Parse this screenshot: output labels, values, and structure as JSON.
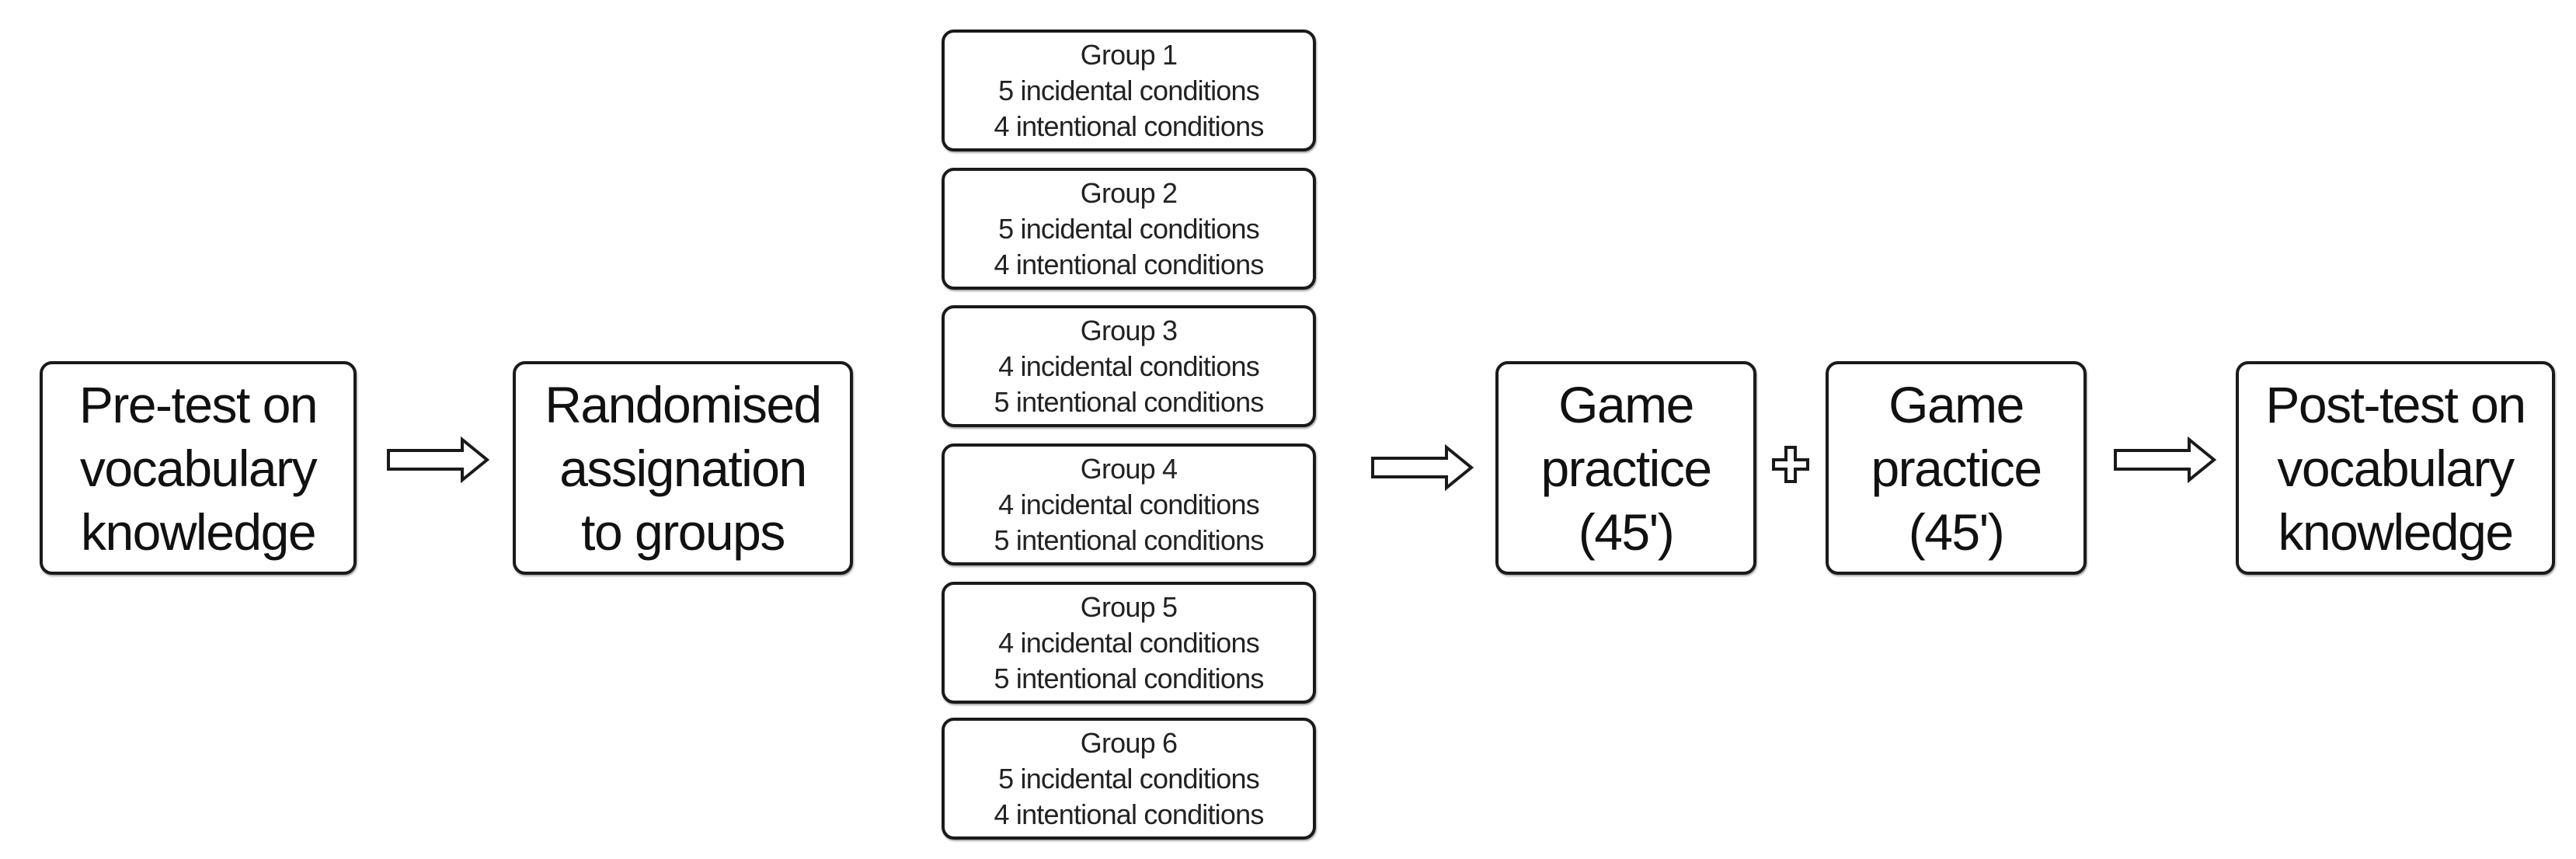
{
  "steps": {
    "pretest": {
      "lines": [
        "Pre-test on",
        "vocabulary",
        "knowledge"
      ]
    },
    "randomised": {
      "lines": [
        "Randomised",
        "assignation",
        "to groups"
      ]
    },
    "game1": {
      "lines": [
        "Game",
        "practice",
        "(45')"
      ]
    },
    "game2": {
      "lines": [
        "Game",
        "practice",
        "(45')"
      ]
    },
    "posttest": {
      "lines": [
        "Post-test on",
        "vocabulary",
        "knowledge"
      ]
    }
  },
  "groups": [
    {
      "title": "Group 1",
      "incidental": "5 incidental conditions",
      "intentional": "4 intentional conditions"
    },
    {
      "title": "Group 2",
      "incidental": "5 incidental conditions",
      "intentional": "4 intentional conditions"
    },
    {
      "title": "Group 3",
      "incidental": "4 incidental conditions",
      "intentional": "5 intentional conditions"
    },
    {
      "title": "Group 4",
      "incidental": "4 incidental conditions",
      "intentional": "5 intentional conditions"
    },
    {
      "title": "Group 5",
      "incidental": "4 incidental conditions",
      "intentional": "5 intentional conditions"
    },
    {
      "title": "Group 6",
      "incidental": "5 incidental conditions",
      "intentional": "4 intentional conditions"
    }
  ],
  "connectors": [
    "arrow-right-icon",
    "arrow-right-icon",
    "plus-icon",
    "arrow-right-icon"
  ]
}
